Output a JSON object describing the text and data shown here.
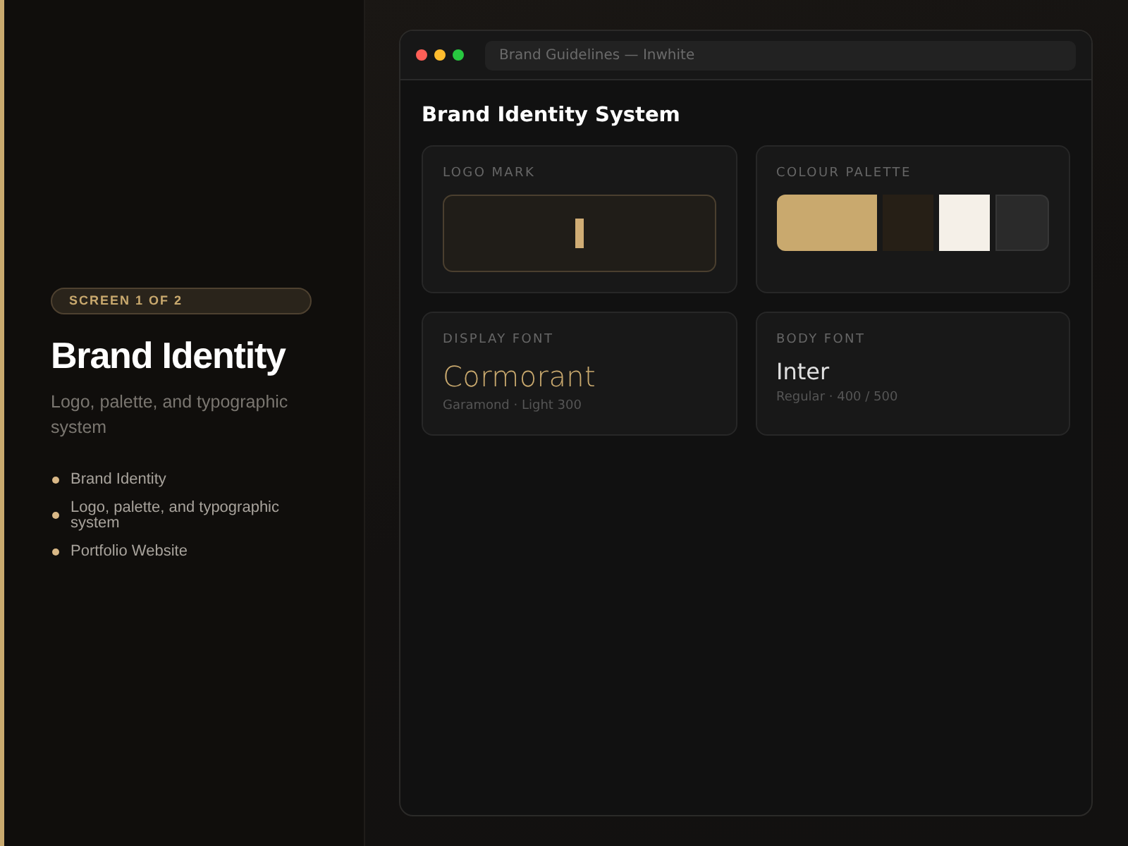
{
  "sidebar": {
    "badge": "SCREEN 1 OF 2",
    "title": "Brand Identity",
    "description": "Logo, palette, and typographic system",
    "items": [
      {
        "label": "Brand Identity"
      },
      {
        "label": "Logo, palette, and typographic system"
      },
      {
        "label": "Portfolio Website"
      }
    ]
  },
  "window": {
    "address": "Brand Guidelines — Inwhite",
    "heading": "Brand Identity System",
    "cards": [
      {
        "kind": "logo",
        "label": "LOGO MARK"
      },
      {
        "kind": "palette",
        "label": "COLOUR PALETTE",
        "swatches": [
          {
            "color": "#c9a96e"
          },
          {
            "color": "#261f16"
          },
          {
            "color": "#f5f0e8"
          },
          {
            "color": "#2a2a2a"
          }
        ]
      },
      {
        "kind": "display",
        "label": "DISPLAY FONT",
        "sample": "Cormorant",
        "detail": "Garamond · Light 300"
      },
      {
        "kind": "body",
        "label": "BODY FONT",
        "sample": "Inter",
        "detail": "Regular · 400 / 500"
      }
    ]
  }
}
